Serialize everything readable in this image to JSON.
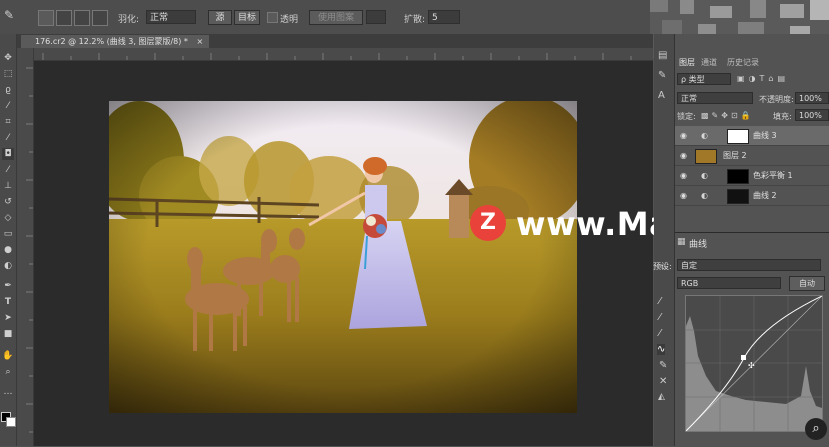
{
  "options_bar": {
    "feather_label": "羽化:",
    "mode_value": "正常",
    "source_label": "源",
    "target_label": "目标",
    "transparent_label": "透明",
    "use_pattern_label": "使用图案",
    "diffusion_label": "扩散:",
    "diffusion_value": "5"
  },
  "document": {
    "tab_title": "176.cr2 @ 12.2% (曲线 3, 图层蒙版/8) *",
    "close_icon": "×"
  },
  "layers_panel": {
    "tabs": [
      "图层",
      "通道",
      "历史记录"
    ],
    "filter_label": "ρ 类型",
    "blend_mode": "正常",
    "opacity_label": "不透明度:",
    "opacity_value": "100%",
    "lock_label": "锁定:",
    "fill_label": "填充:",
    "fill_value": "100%",
    "layers": [
      {
        "name": "曲线 3",
        "kind": "curves",
        "selected": true
      },
      {
        "name": "图层 2",
        "kind": "image",
        "selected": false
      },
      {
        "name": "色彩平衡 1",
        "kind": "balance",
        "selected": false
      },
      {
        "name": "曲线 2",
        "kind": "curves",
        "selected": false
      }
    ]
  },
  "properties_panel": {
    "title": "曲线",
    "preset_label": "预设:",
    "preset_value": "自定",
    "channel_value": "RGB",
    "auto_button": "自动"
  },
  "watermark": {
    "logo_letter": "Z",
    "text": "www.MacZ.com",
    "color": "#e8423a"
  },
  "icons": [
    "move-icon",
    "marquee-icon",
    "lasso-icon",
    "magic-wand-icon",
    "crop-icon",
    "eyedropper-icon",
    "healing-icon",
    "brush-icon",
    "stamp-icon",
    "history-brush-icon",
    "eraser-icon",
    "gradient-icon",
    "blur-icon",
    "dodge-icon",
    "pen-icon",
    "type-icon",
    "path-select-icon",
    "shape-icon",
    "hand-icon",
    "zoom-icon"
  ]
}
